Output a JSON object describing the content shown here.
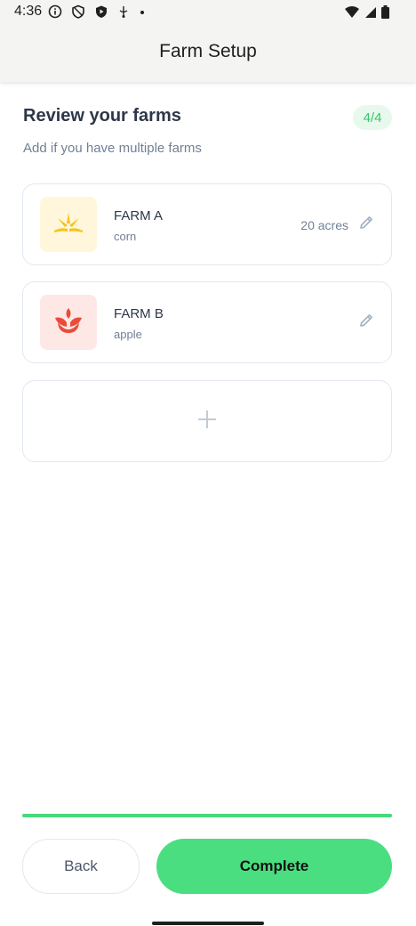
{
  "status_bar": {
    "time": "4:36",
    "icons_left": [
      "info-icon",
      "shield-icon",
      "play-protect-icon",
      "usb-icon",
      "dot-icon"
    ],
    "icons_right": [
      "wifi-icon",
      "signal-icon",
      "battery-icon"
    ]
  },
  "app_bar": {
    "title": "Farm Setup"
  },
  "review": {
    "title": "Review your farms",
    "step": "4/4",
    "subtitle": "Add if you have multiple farms"
  },
  "farms": [
    {
      "name": "FARM A",
      "crop": "corn",
      "acres": "20 acres",
      "icon": "corn-icon",
      "icon_bg": "#fff6dc",
      "icon_color": "#f5c518"
    },
    {
      "name": "FARM B",
      "crop": "apple",
      "acres": "",
      "icon": "apple-flower-icon",
      "icon_bg": "#fde8e6",
      "icon_color": "#ea4c3a"
    }
  ],
  "add_farm": {
    "icon": "plus-icon"
  },
  "progress": {
    "value": 1.0,
    "color": "#48d97a"
  },
  "buttons": {
    "back": "Back",
    "complete": "Complete"
  },
  "colors": {
    "accent": "#4ade80",
    "badge_bg": "#e6f9ec",
    "badge_text": "#3cc46b"
  }
}
